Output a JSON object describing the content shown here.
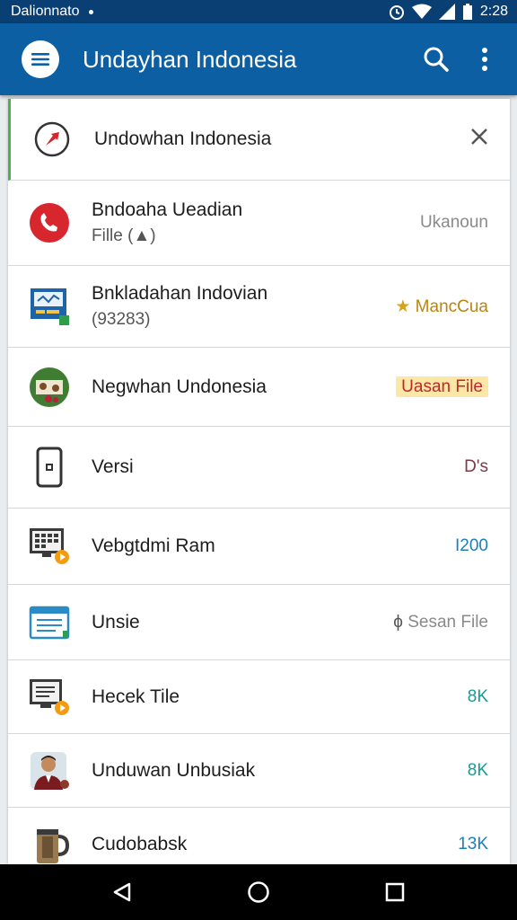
{
  "status_bar": {
    "carrier": "Dalionnato",
    "time": "2:28"
  },
  "app_bar": {
    "title": "Undayhan Indonesia"
  },
  "list": [
    {
      "title": "Undowhan Indonesia",
      "subtitle": "",
      "meta": ""
    },
    {
      "title": "Bndoaha Ueadian",
      "subtitle": "Fille (▲)",
      "meta": "Ukanoun"
    },
    {
      "title": "Bnkladahan Indovian",
      "subtitle": "(93283)",
      "meta": "MancCua"
    },
    {
      "title": "Negwhan Undonesia",
      "subtitle": "",
      "meta": "Uasan File"
    },
    {
      "title": "Versi",
      "subtitle": "",
      "meta": "D's"
    },
    {
      "title": "Vebgtdmi Ram",
      "subtitle": "",
      "meta": "I200"
    },
    {
      "title": "Unsie",
      "subtitle": "",
      "meta": "Sesan File"
    },
    {
      "title": "Hecek Tile",
      "subtitle": "",
      "meta": "8K"
    },
    {
      "title": "Unduwan Unbusiak",
      "subtitle": "",
      "meta": "8K"
    },
    {
      "title": "Cudobabsk",
      "subtitle": "",
      "meta": "13K"
    }
  ],
  "colors": {
    "app_bar": "#0d5fa3",
    "status_bar": "#0a3f73",
    "meta_gray": "#8a8a8a",
    "meta_gold": "#b8860b",
    "meta_red": "#c0262d",
    "meta_maroon": "#7a3a4a",
    "meta_blue": "#1d7fb8",
    "meta_teal": "#1a9a94"
  },
  "icons": {
    "row0": "compass-icon",
    "row1": "phone-icon",
    "row2": "monitor-chart-icon",
    "row3": "nature-photo-icon",
    "row4": "smartphone-icon",
    "row5": "calendar-screen-icon",
    "row6": "document-window-icon",
    "row7": "monitor-file-icon",
    "row8": "avatar-photo-icon",
    "row9": "mug-icon",
    "close": "close-icon"
  }
}
